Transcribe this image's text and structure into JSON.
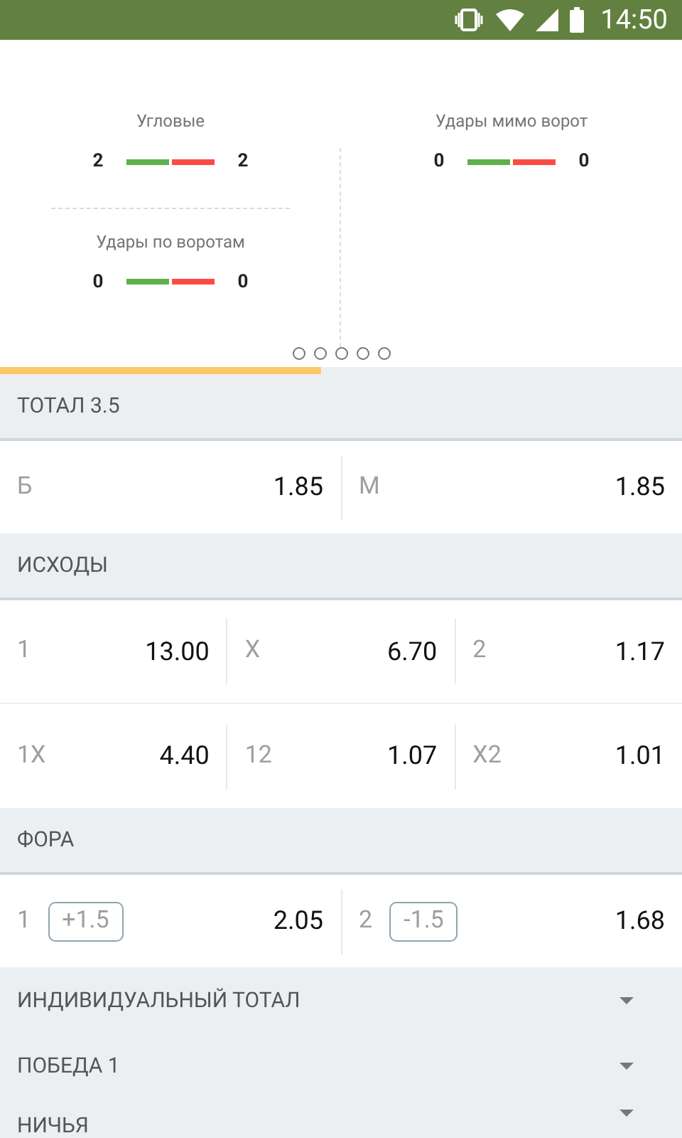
{
  "status_bar": {
    "time": "14:50"
  },
  "stats": {
    "left": [
      {
        "title": "Угловые",
        "home": "2",
        "away": "2"
      },
      {
        "title": "Удары по воротам",
        "home": "0",
        "away": "0"
      }
    ],
    "right": [
      {
        "title": "Удары мимо ворот",
        "home": "0",
        "away": "0"
      }
    ]
  },
  "progress": {
    "level": 0.47
  },
  "markets": [
    {
      "kind": "grid",
      "title": "ТОТАЛ 3.5",
      "rows": [
        [
          {
            "label": "Б",
            "odds": "1.85"
          },
          {
            "label": "М",
            "odds": "1.85"
          }
        ]
      ]
    },
    {
      "kind": "grid",
      "title": "ИСХОДЫ",
      "rows": [
        [
          {
            "label": "1",
            "odds": "13.00"
          },
          {
            "label": "X",
            "odds": "6.70"
          },
          {
            "label": "2",
            "odds": "1.17"
          }
        ],
        [
          {
            "label": "1X",
            "odds": "4.40"
          },
          {
            "label": "12",
            "odds": "1.07"
          },
          {
            "label": "X2",
            "odds": "1.01"
          }
        ]
      ]
    },
    {
      "kind": "grid",
      "title": "ФОРА",
      "rows": [
        [
          {
            "label": "1",
            "handicap": "+1.5",
            "odds": "2.05"
          },
          {
            "label": "2",
            "handicap": "-1.5",
            "odds": "1.68"
          }
        ]
      ]
    },
    {
      "kind": "collapsed",
      "title": "ИНДИВИДУАЛЬНЫЙ ТОТАЛ"
    },
    {
      "kind": "collapsed",
      "title": "ПОБЕДА 1"
    },
    {
      "kind": "collapsed",
      "title": "НИЧЬЯ"
    }
  ]
}
